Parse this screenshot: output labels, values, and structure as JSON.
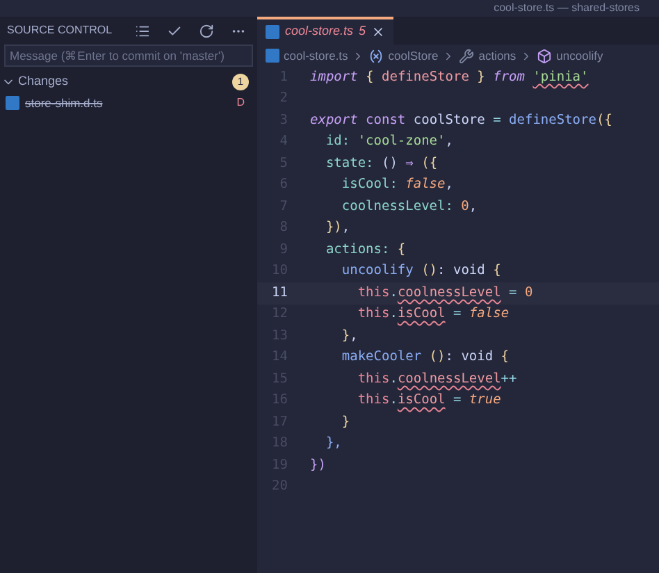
{
  "window": {
    "title": "cool-store.ts — shared-stores"
  },
  "sidebar": {
    "title": "SOURCE CONTROL",
    "commit_message": {
      "placeholder": "Message (⌘Enter to commit on 'master')"
    },
    "changes": {
      "label": "Changes",
      "expanded": true,
      "count": "1",
      "files": [
        {
          "name": "store-shim.d.ts",
          "status": "D",
          "deleted": true
        }
      ]
    }
  },
  "tab": {
    "label": "cool-store.ts",
    "problems": "5",
    "selected": true,
    "has_errors": true
  },
  "breadcrumbs": [
    {
      "kind": "file",
      "label": "cool-store.ts"
    },
    {
      "kind": "variable",
      "label": "coolStore"
    },
    {
      "kind": "property",
      "label": "actions"
    },
    {
      "kind": "method",
      "label": "uncoolify"
    }
  ],
  "code": [
    {
      "number": "1",
      "current": false,
      "tokens": [
        {
          "t": "import",
          "kind": "kwi"
        },
        {
          "t": " { ",
          "kind": "punct"
        },
        {
          "t": "defineStore",
          "kind": "imp"
        },
        {
          "t": " } ",
          "kind": "punct"
        },
        {
          "t": "from ",
          "kind": "kwi"
        },
        {
          "t": "'pinia'",
          "kind": "str",
          "squiggle": true
        }
      ]
    },
    {
      "number": "2",
      "current": false
    },
    {
      "number": "3",
      "current": false,
      "tokens": [
        {
          "t": "export",
          "kind": "kwi"
        },
        {
          "t": " const ",
          "kind": "kw"
        },
        {
          "t": "coolStore",
          "kind": "text"
        },
        {
          "t": " = ",
          "kind": "op"
        },
        {
          "t": "defineStore",
          "kind": "fn"
        },
        {
          "t": "({",
          "kind": "punct"
        }
      ]
    },
    {
      "number": "4",
      "current": false,
      "tokens": [
        {
          "t": "  id: ",
          "kind": "prop"
        },
        {
          "t": "'cool-zone'",
          "kind": "str"
        },
        {
          "t": ",",
          "kind": "text"
        }
      ]
    },
    {
      "number": "5",
      "current": false,
      "tokens": [
        {
          "t": "  state: ",
          "kind": "prop"
        },
        {
          "t": "() ",
          "kind": "text"
        },
        {
          "t": "⇒",
          "kind": "kw"
        },
        {
          "t": " ({",
          "kind": "punct"
        }
      ]
    },
    {
      "number": "6",
      "current": false,
      "tokens": [
        {
          "t": "    isCool: ",
          "kind": "prop"
        },
        {
          "t": "false",
          "kind": "consti"
        },
        {
          "t": ",",
          "kind": "text"
        }
      ]
    },
    {
      "number": "7",
      "current": false,
      "tokens": [
        {
          "t": "    coolnessLevel: ",
          "kind": "prop"
        },
        {
          "t": "0",
          "kind": "const"
        },
        {
          "t": ",",
          "kind": "text"
        }
      ]
    },
    {
      "number": "8",
      "current": false,
      "tokens": [
        {
          "t": "  })",
          "kind": "punct"
        },
        {
          "t": ",",
          "kind": "text"
        }
      ]
    },
    {
      "number": "9",
      "current": false,
      "tokens": [
        {
          "t": "  actions: ",
          "kind": "prop"
        },
        {
          "t": "{",
          "kind": "punct"
        }
      ]
    },
    {
      "number": "10",
      "current": false,
      "tokens": [
        {
          "t": "    uncoolify ",
          "kind": "fn"
        },
        {
          "t": "()",
          "kind": "punct"
        },
        {
          "t": ": void ",
          "kind": "text"
        },
        {
          "t": "{",
          "kind": "punct"
        }
      ]
    },
    {
      "number": "11",
      "current": true,
      "tokens": [
        {
          "t": "      this",
          "kind": "this"
        },
        {
          "t": ".",
          "kind": "op"
        },
        {
          "t": "coolnessLevel",
          "kind": "err",
          "squiggle": true
        },
        {
          "t": " = ",
          "kind": "op"
        },
        {
          "t": "0",
          "kind": "const"
        }
      ]
    },
    {
      "number": "12",
      "current": false,
      "tokens": [
        {
          "t": "      this",
          "kind": "this"
        },
        {
          "t": ".",
          "kind": "op"
        },
        {
          "t": "isCool",
          "kind": "err",
          "squiggle": true
        },
        {
          "t": " = ",
          "kind": "op"
        },
        {
          "t": "false",
          "kind": "consti"
        }
      ]
    },
    {
      "number": "13",
      "current": false,
      "tokens": [
        {
          "t": "    }",
          "kind": "punct"
        },
        {
          "t": ",",
          "kind": "text"
        }
      ]
    },
    {
      "number": "14",
      "current": false,
      "tokens": [
        {
          "t": "    makeCooler ",
          "kind": "fn"
        },
        {
          "t": "()",
          "kind": "punct"
        },
        {
          "t": ": void ",
          "kind": "text"
        },
        {
          "t": "{",
          "kind": "punct"
        }
      ]
    },
    {
      "number": "15",
      "current": false,
      "tokens": [
        {
          "t": "      this",
          "kind": "this"
        },
        {
          "t": ".",
          "kind": "op"
        },
        {
          "t": "coolnessLevel",
          "kind": "err",
          "squiggle": true
        },
        {
          "t": "++",
          "kind": "op"
        }
      ]
    },
    {
      "number": "16",
      "current": false,
      "tokens": [
        {
          "t": "      this",
          "kind": "this"
        },
        {
          "t": ".",
          "kind": "op"
        },
        {
          "t": "isCool",
          "kind": "err",
          "squiggle": true
        },
        {
          "t": " = ",
          "kind": "op"
        },
        {
          "t": "true",
          "kind": "consti"
        }
      ]
    },
    {
      "number": "17",
      "current": false,
      "tokens": [
        {
          "t": "    }",
          "kind": "punct"
        }
      ]
    },
    {
      "number": "18",
      "current": false,
      "tokens": [
        {
          "t": "  },",
          "kind": "bracket2"
        }
      ]
    },
    {
      "number": "19",
      "current": false,
      "tokens": [
        {
          "t": "})",
          "kind": "bracket3"
        }
      ]
    },
    {
      "number": "20",
      "current": false
    }
  ]
}
